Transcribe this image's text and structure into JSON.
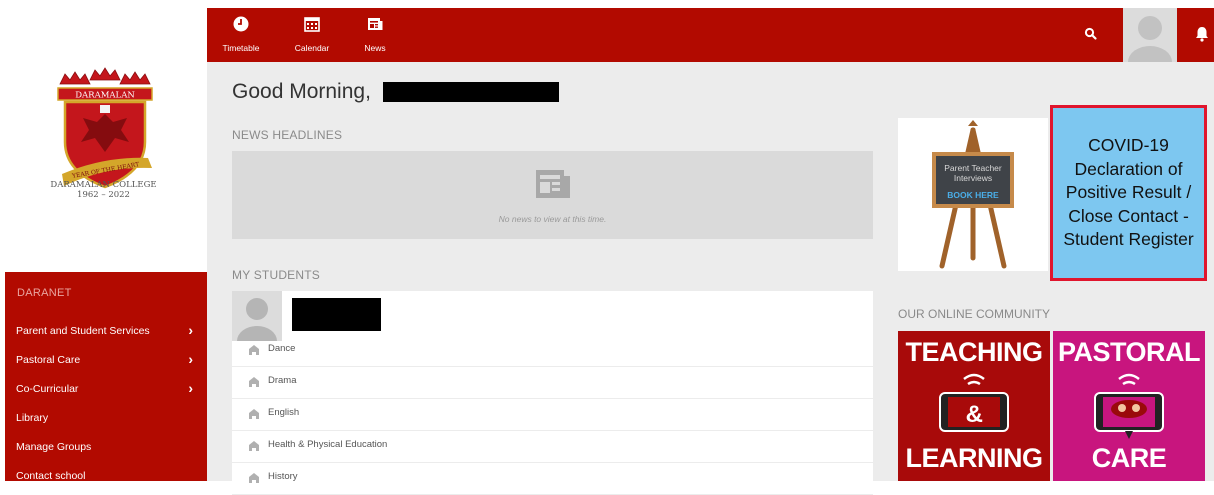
{
  "sidebar": {
    "college_name": "DARAMALAN COLLEGE",
    "college_years": "1962 – 2022",
    "logo_banner": "DARAMALAN",
    "logo_ribbon": "YEAR OF THE HEART",
    "menu_heading": "DARANET",
    "items": [
      {
        "label": "Parent and Student Services",
        "has_submenu": true
      },
      {
        "label": "Pastoral Care",
        "has_submenu": true
      },
      {
        "label": "Co-Curricular",
        "has_submenu": true
      },
      {
        "label": "Library",
        "has_submenu": false
      },
      {
        "label": "Manage Groups",
        "has_submenu": false
      },
      {
        "label": "Contact school",
        "has_submenu": false
      }
    ]
  },
  "topbar": {
    "timetable_label": "Timetable",
    "calendar_label": "Calendar",
    "news_label": "News",
    "icons": [
      "clock-icon",
      "calendar-icon",
      "news-icon",
      "search-icon",
      "bell-icon"
    ]
  },
  "main": {
    "greeting": "Good Morning,",
    "news_section_title": "NEWS HEADLINES",
    "news_empty_text": "No news to view at this time.",
    "students_section_title": "MY STUDENTS",
    "subjects": [
      "Dance",
      "Drama",
      "English",
      "Health & Physical Education",
      "History"
    ]
  },
  "right": {
    "pt_board_line1": "Parent Teacher",
    "pt_board_line2": "Interviews",
    "pt_board_cta": "BOOK HERE",
    "covid_text": "COVID-19 Declaration of Positive Result / Close Contact - Student Register",
    "online_title": "OUR ONLINE COMMUNITY",
    "tile1_top": "TEACHING",
    "tile1_mid": "&",
    "tile1_bottom": "LEARNING",
    "tile2_top": "PASTORAL",
    "tile2_bottom": "CARE"
  },
  "colors": {
    "brand_red": "#b20a00",
    "covid_bg": "#7dc7f0",
    "covid_border": "#e0152d",
    "tile_teaching": "#a80a0a",
    "tile_pastoral": "#c8157e"
  }
}
